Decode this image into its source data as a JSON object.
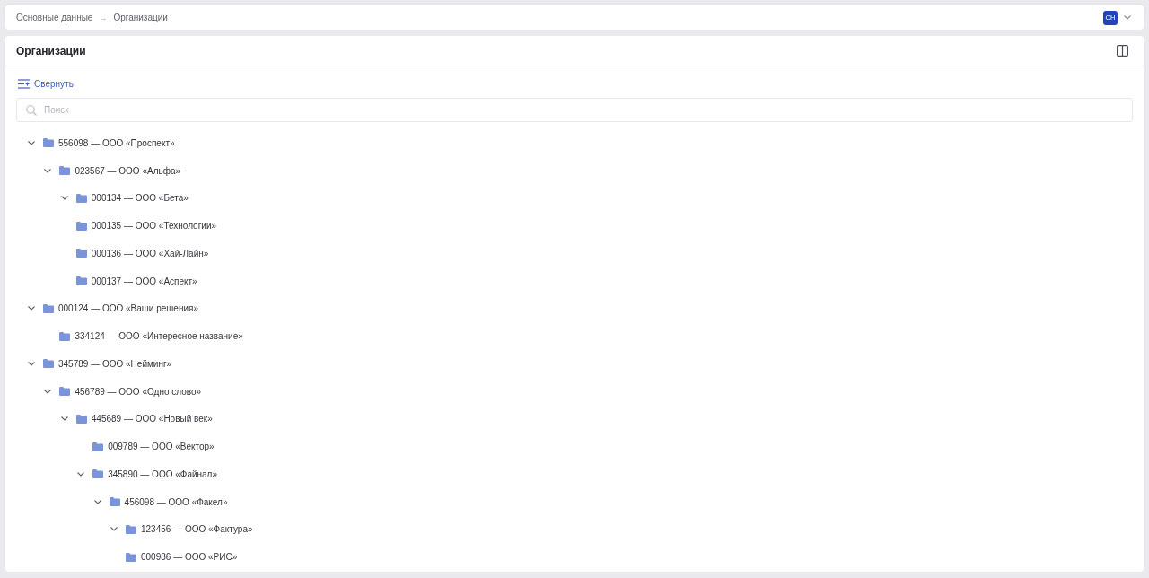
{
  "breadcrumb": {
    "items": [
      "Основные данные",
      "Организации"
    ],
    "separator": "→"
  },
  "user": {
    "initials": "СН"
  },
  "panel": {
    "title": "Организации",
    "collapse_button": "Свернуть",
    "search": {
      "placeholder": "Поиск"
    }
  },
  "tree": [
    {
      "label": "556098 — ООО «Проспект»",
      "kind": "branch",
      "expanded": true,
      "children": [
        {
          "label": "023567 — ООО «Альфа»",
          "kind": "branch",
          "expanded": true,
          "children": [
            {
              "label": "000134 — ООО «Бета»",
              "kind": "branch",
              "expanded": true
            },
            {
              "label": "000135 — ООО «Технологии»",
              "kind": "leaf"
            },
            {
              "label": "000136 — ООО «Хай-Лайн»",
              "kind": "leaf"
            },
            {
              "label": "000137 — ООО «Аспект»",
              "kind": "leaf"
            }
          ]
        }
      ]
    },
    {
      "label": "000124 — ООО «Ваши решения»",
      "kind": "branch",
      "expanded": true,
      "children": [
        {
          "label": "334124 — ООО «Интересное название»",
          "kind": "leaf"
        }
      ]
    },
    {
      "label": "345789 — ООО «Нейминг»",
      "kind": "branch",
      "expanded": true,
      "children": [
        {
          "label": "456789 — ООО «Одно слово»",
          "kind": "branch",
          "expanded": true,
          "children": [
            {
              "label": "445689 — ООО «Новый век»",
              "kind": "branch",
              "expanded": true,
              "children": [
                {
                  "label": "009789 — ООО «Вектор»",
                  "kind": "leaf"
                },
                {
                  "label": "345890 — ООО «Файнал»",
                  "kind": "branch",
                  "expanded": true,
                  "children": [
                    {
                      "label": "456098 — ООО «Факел»",
                      "kind": "branch",
                      "expanded": true,
                      "children": [
                        {
                          "label": "123456 — ООО «Фактура»",
                          "kind": "branch",
                          "expanded": true
                        },
                        {
                          "label": "000986 — ООО «РИС»",
                          "kind": "leaf"
                        }
                      ]
                    }
                  ]
                }
              ]
            }
          ]
        }
      ]
    }
  ]
}
